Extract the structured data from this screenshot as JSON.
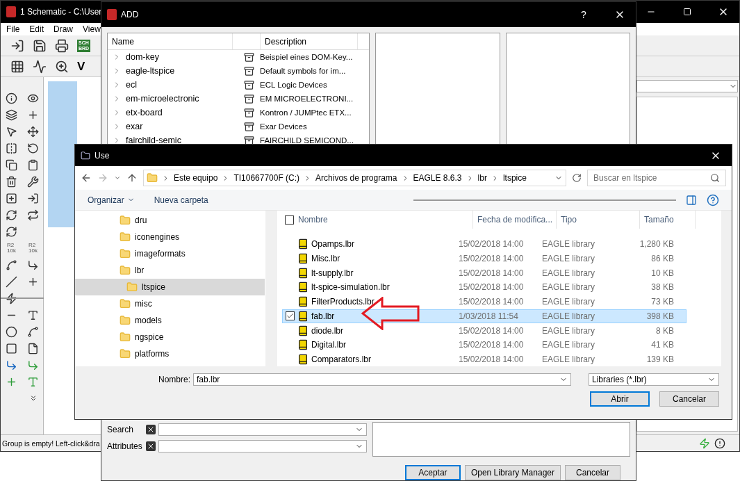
{
  "main_window": {
    "title": "1 Schematic - C:\\User",
    "menu": [
      "File",
      "Edit",
      "Draw",
      "View"
    ],
    "toolbar_badge": [
      "SCH",
      "BRD"
    ],
    "toolbar_glyph": "V",
    "value_labels": [
      "R2",
      "10k",
      "R2",
      "10k"
    ],
    "status": "Group is empty! Left-click&dra"
  },
  "add_dialog": {
    "title": "ADD",
    "help": "?",
    "columns": [
      "Name",
      "Description"
    ],
    "rows": [
      {
        "name": "dom-key",
        "description": "Beispiel eines DOM-Key..."
      },
      {
        "name": "eagle-ltspice",
        "description": "Default symbols for im..."
      },
      {
        "name": "ecl",
        "description": "ECL Logic Devices"
      },
      {
        "name": "em-microelectronic",
        "description": "EM MICROELECTRONI..."
      },
      {
        "name": "etx-board",
        "description": "Kontron / JUMPtec ETX..."
      },
      {
        "name": "exar",
        "description": "Exar Devices"
      },
      {
        "name": "fairchild-semic",
        "description": "FAIRCHILD SEMICOND..."
      }
    ],
    "search_label": "Search",
    "attributes_label": "Attributes",
    "buttons": [
      "Aceptar",
      "Open Library Manager",
      "Cancelar"
    ]
  },
  "use_dialog": {
    "title": "Use",
    "path": [
      "Este equipo",
      "TI10667700F (C:)",
      "Archivos de programa",
      "EAGLE 8.6.3",
      "lbr",
      "ltspice"
    ],
    "search": {
      "placeholder": "Buscar en ltspice"
    },
    "commands": [
      "Organizar",
      "Nueva carpeta"
    ],
    "folders": [
      {
        "label": "dru",
        "selected": false
      },
      {
        "label": "iconengines",
        "selected": false
      },
      {
        "label": "imageformats",
        "selected": false
      },
      {
        "label": "lbr",
        "selected": false,
        "children": [
          {
            "label": "ltspice",
            "selected": true
          }
        ]
      },
      {
        "label": "misc",
        "selected": false
      },
      {
        "label": "models",
        "selected": false
      },
      {
        "label": "ngspice",
        "selected": false
      },
      {
        "label": "platforms",
        "selected": false
      }
    ],
    "columns": [
      "Nombre",
      "Fecha de modifica...",
      "Tipo",
      "Tamaño"
    ],
    "select_all_checked": false,
    "files": [
      {
        "name": "Opamps.lbr",
        "date": "15/02/2018 14:00",
        "type": "EAGLE library",
        "size": "1,280 KB",
        "selected": false
      },
      {
        "name": "Misc.lbr",
        "date": "15/02/2018 14:00",
        "type": "EAGLE library",
        "size": "86 KB",
        "selected": false
      },
      {
        "name": "lt-supply.lbr",
        "date": "15/02/2018 14:00",
        "type": "EAGLE library",
        "size": "10 KB",
        "selected": false
      },
      {
        "name": "lt-spice-simulation.lbr",
        "date": "15/02/2018 14:00",
        "type": "EAGLE library",
        "size": "38 KB",
        "selected": false
      },
      {
        "name": "FilterProducts.lbr",
        "date": "15/02/2018 14:00",
        "type": "EAGLE library",
        "size": "73 KB",
        "selected": false
      },
      {
        "name": "fab.lbr",
        "date": "1/03/2018 11:54",
        "type": "EAGLE library",
        "size": "398 KB",
        "selected": true
      },
      {
        "name": "diode.lbr",
        "date": "15/02/2018 14:00",
        "type": "EAGLE library",
        "size": "8 KB",
        "selected": false
      },
      {
        "name": "Digital.lbr",
        "date": "15/02/2018 14:00",
        "type": "EAGLE library",
        "size": "41 KB",
        "selected": false
      },
      {
        "name": "Comparators.lbr",
        "date": "15/02/2018 14:00",
        "type": "EAGLE library",
        "size": "139 KB",
        "selected": false
      }
    ],
    "filename_label": "Nombre:",
    "filename": "fab.lbr",
    "filter": "Libraries (*.lbr)",
    "buttons": [
      "Abrir",
      "Cancelar"
    ]
  }
}
